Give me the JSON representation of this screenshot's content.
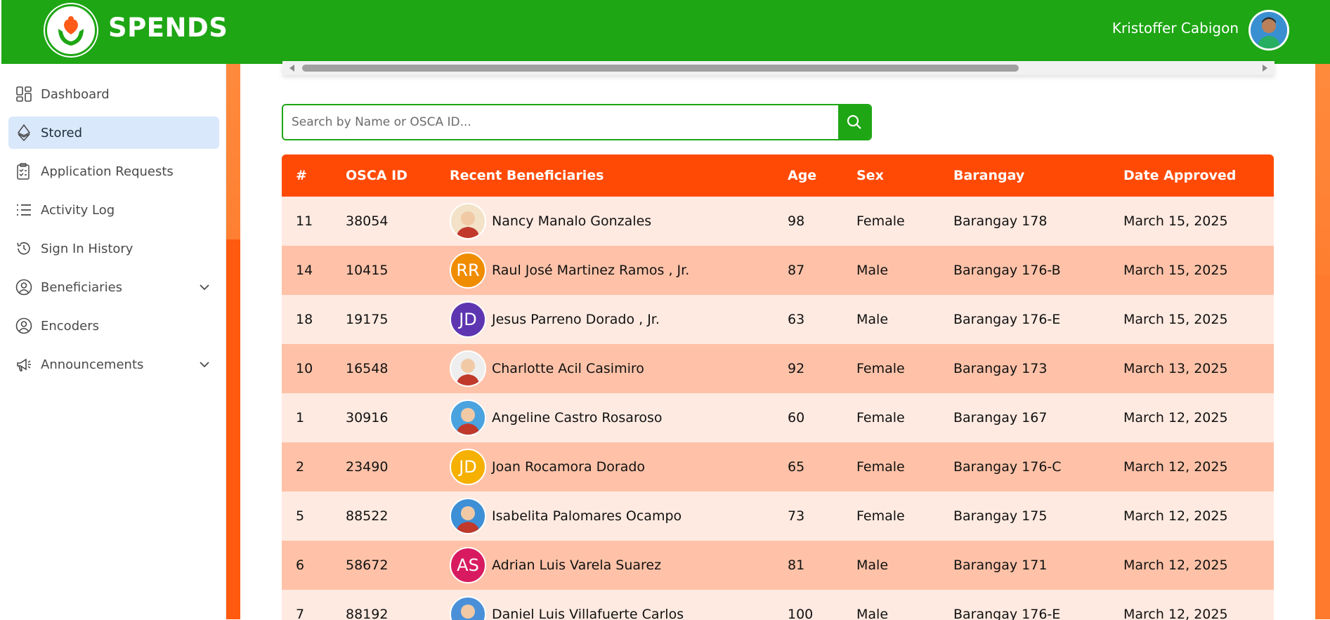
{
  "header": {
    "brand": "SPENDS",
    "user_name": "Kristoffer Cabigon"
  },
  "sidebar": {
    "items": [
      {
        "label": "Dashboard",
        "icon": "dashboard-icon"
      },
      {
        "label": "Stored",
        "icon": "ethereum-icon",
        "active": true
      },
      {
        "label": "Application Requests",
        "icon": "clipboard-icon"
      },
      {
        "label": "Activity Log",
        "icon": "list-icon"
      },
      {
        "label": "Sign In History",
        "icon": "history-icon"
      },
      {
        "label": "Beneficiaries",
        "icon": "user-circle-icon",
        "expandable": true
      },
      {
        "label": "Encoders",
        "icon": "user-circle-icon"
      },
      {
        "label": "Announcements",
        "icon": "megaphone-icon",
        "expandable": true
      }
    ]
  },
  "search": {
    "placeholder": "Search by Name or OSCA ID...",
    "value": ""
  },
  "table": {
    "columns": [
      "#",
      "OSCA ID",
      "Recent Beneficiaries",
      "Age",
      "Sex",
      "Barangay",
      "Date Approved"
    ],
    "rows": [
      {
        "num": "11",
        "osca": "38054",
        "name": "Nancy Manalo Gonzales",
        "age": "98",
        "sex": "Female",
        "barangay": "Barangay 178",
        "date": "March 15, 2025",
        "avatar": {
          "type": "photo",
          "color": "#f3e2c7"
        }
      },
      {
        "num": "14",
        "osca": "10415",
        "name": "Raul José Martinez Ramos , Jr.",
        "age": "87",
        "sex": "Male",
        "barangay": "Barangay 176-B",
        "date": "March 15, 2025",
        "avatar": {
          "type": "initials",
          "initials": "RR",
          "color": "#f08c00"
        }
      },
      {
        "num": "18",
        "osca": "19175",
        "name": "Jesus Parreno Dorado , Jr.",
        "age": "63",
        "sex": "Male",
        "barangay": "Barangay 176-E",
        "date": "March 15, 2025",
        "avatar": {
          "type": "initials",
          "initials": "JD",
          "color": "#5e35b1"
        }
      },
      {
        "num": "10",
        "osca": "16548",
        "name": "Charlotte Acil Casimiro",
        "age": "92",
        "sex": "Female",
        "barangay": "Barangay 173",
        "date": "March 13, 2025",
        "avatar": {
          "type": "photo",
          "color": "#eeeeee"
        }
      },
      {
        "num": "1",
        "osca": "30916",
        "name": "Angeline Castro Rosaroso",
        "age": "60",
        "sex": "Female",
        "barangay": "Barangay 167",
        "date": "March 12, 2025",
        "avatar": {
          "type": "photo",
          "color": "#4aa3df"
        }
      },
      {
        "num": "2",
        "osca": "23490",
        "name": "Joan Rocamora Dorado",
        "age": "65",
        "sex": "Female",
        "barangay": "Barangay 176-C",
        "date": "March 12, 2025",
        "avatar": {
          "type": "initials",
          "initials": "JD",
          "color": "#f5b000"
        }
      },
      {
        "num": "5",
        "osca": "88522",
        "name": "Isabelita Palomares Ocampo",
        "age": "73",
        "sex": "Female",
        "barangay": "Barangay 175",
        "date": "March 12, 2025",
        "avatar": {
          "type": "photo",
          "color": "#3d8fd6"
        }
      },
      {
        "num": "6",
        "osca": "58672",
        "name": "Adrian Luis Varela Suarez",
        "age": "81",
        "sex": "Male",
        "barangay": "Barangay 171",
        "date": "March 12, 2025",
        "avatar": {
          "type": "initials",
          "initials": "AS",
          "color": "#d81b60"
        }
      },
      {
        "num": "7",
        "osca": "88192",
        "name": "Daniel Luis Villafuerte Carlos",
        "age": "100",
        "sex": "Male",
        "barangay": "Barangay 176-E",
        "date": "March 12, 2025",
        "avatar": {
          "type": "photo",
          "color": "#4a90d9"
        }
      }
    ]
  },
  "colors": {
    "brand_green": "#1ea614",
    "header_orange": "#ff4a06",
    "row_light": "#ffeae1",
    "row_dark": "#ffc2a8",
    "active_nav": "#d9e8fa"
  }
}
